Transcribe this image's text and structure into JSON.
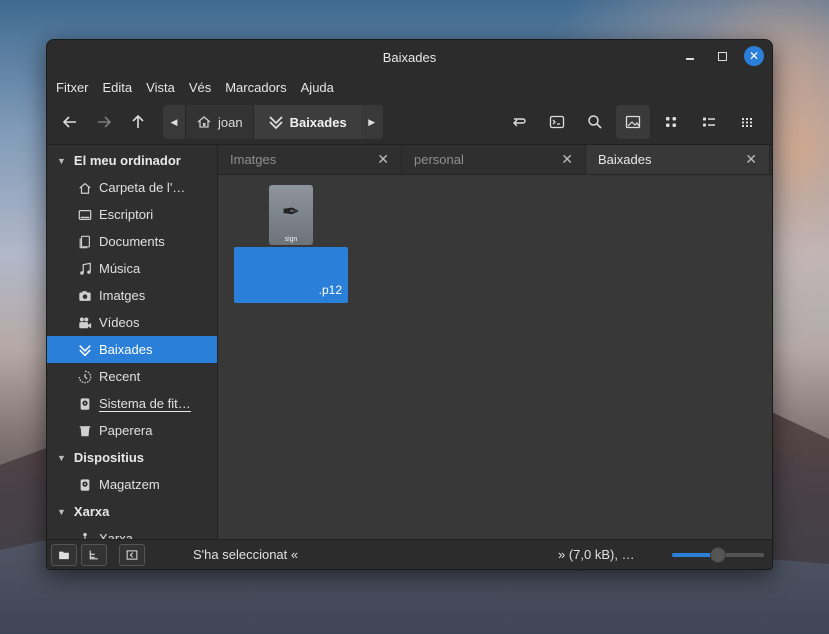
{
  "window": {
    "title": "Baixades"
  },
  "menu": [
    "Fitxer",
    "Edita",
    "Vista",
    "Vés",
    "Marcadors",
    "Ajuda"
  ],
  "toolbar": {
    "back_icon": "arrow-left-icon",
    "forward_icon": "arrow-right-icon",
    "up_icon": "arrow-up-icon",
    "path": [
      {
        "label": "joan",
        "icon": "home-icon"
      },
      {
        "label": "Baixades",
        "icon": "download-icon"
      }
    ]
  },
  "sidebar": {
    "sections": [
      {
        "title": "El meu ordinador"
      },
      {
        "title": "Dispositius"
      },
      {
        "title": "Xarxa"
      }
    ],
    "computer_items": [
      {
        "label": "Carpeta de l'…"
      },
      {
        "label": "Escriptori"
      },
      {
        "label": "Documents"
      },
      {
        "label": "Música"
      },
      {
        "label": "Imatges"
      },
      {
        "label": "Vídeos"
      },
      {
        "label": "Baixades"
      },
      {
        "label": "Recent"
      },
      {
        "label": "Sistema de fit…"
      },
      {
        "label": "Paperera"
      }
    ],
    "device_items": [
      {
        "label": "Magatzem"
      }
    ],
    "network_items": [
      {
        "label": "Xarxa"
      }
    ]
  },
  "tabs": [
    {
      "label": "Imatges",
      "active": false
    },
    {
      "label": "personal",
      "active": false
    },
    {
      "label": "Baixades",
      "active": true
    }
  ],
  "files": [
    {
      "icon_tag": "sign",
      "name": ".p12",
      "selected": true
    }
  ],
  "status": {
    "left": "S'ha seleccionat «",
    "right": "» (7,0 kB), …",
    "zoom_fraction": 0.5
  },
  "colors": {
    "accent": "#2a7fd9",
    "window_bg": "#2c2c2c",
    "view_bg": "#383838"
  }
}
